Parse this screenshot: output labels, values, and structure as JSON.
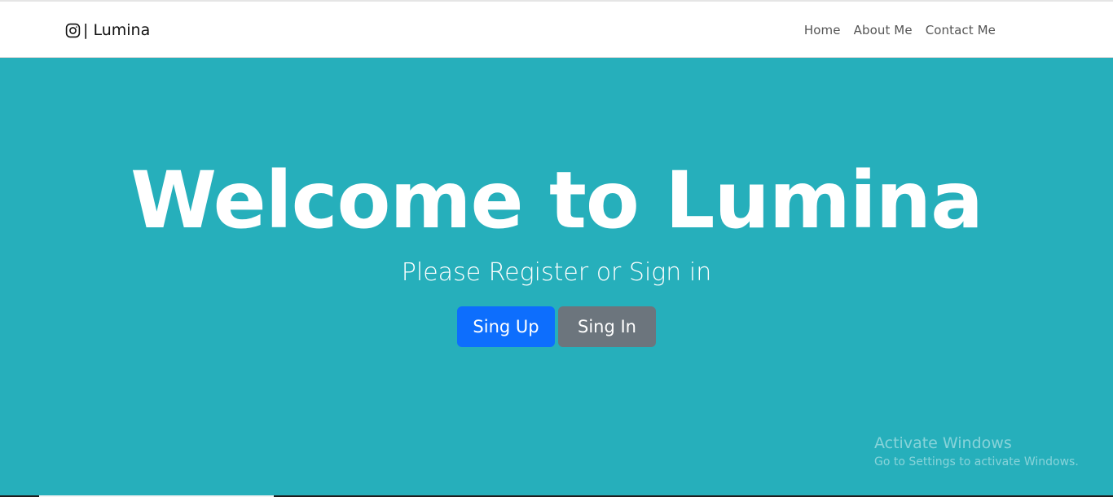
{
  "navbar": {
    "brand_icon": "instagram-icon",
    "brand_text": "| Lumina",
    "links": [
      "Home",
      "About Me",
      "Contact Me"
    ]
  },
  "hero": {
    "title": "Welcome to Lumina",
    "subtitle": "Please Register or Sign in",
    "buttons": {
      "signup": "Sing Up",
      "signin": "Sing In"
    }
  },
  "watermark": {
    "title": "Activate Windows",
    "subtitle": "Go to Settings to activate Windows."
  },
  "colors": {
    "hero_bg": "#26afbb",
    "primary": "#0d6efd",
    "secondary": "#6c757d",
    "nav_bg": "#ffffff"
  }
}
